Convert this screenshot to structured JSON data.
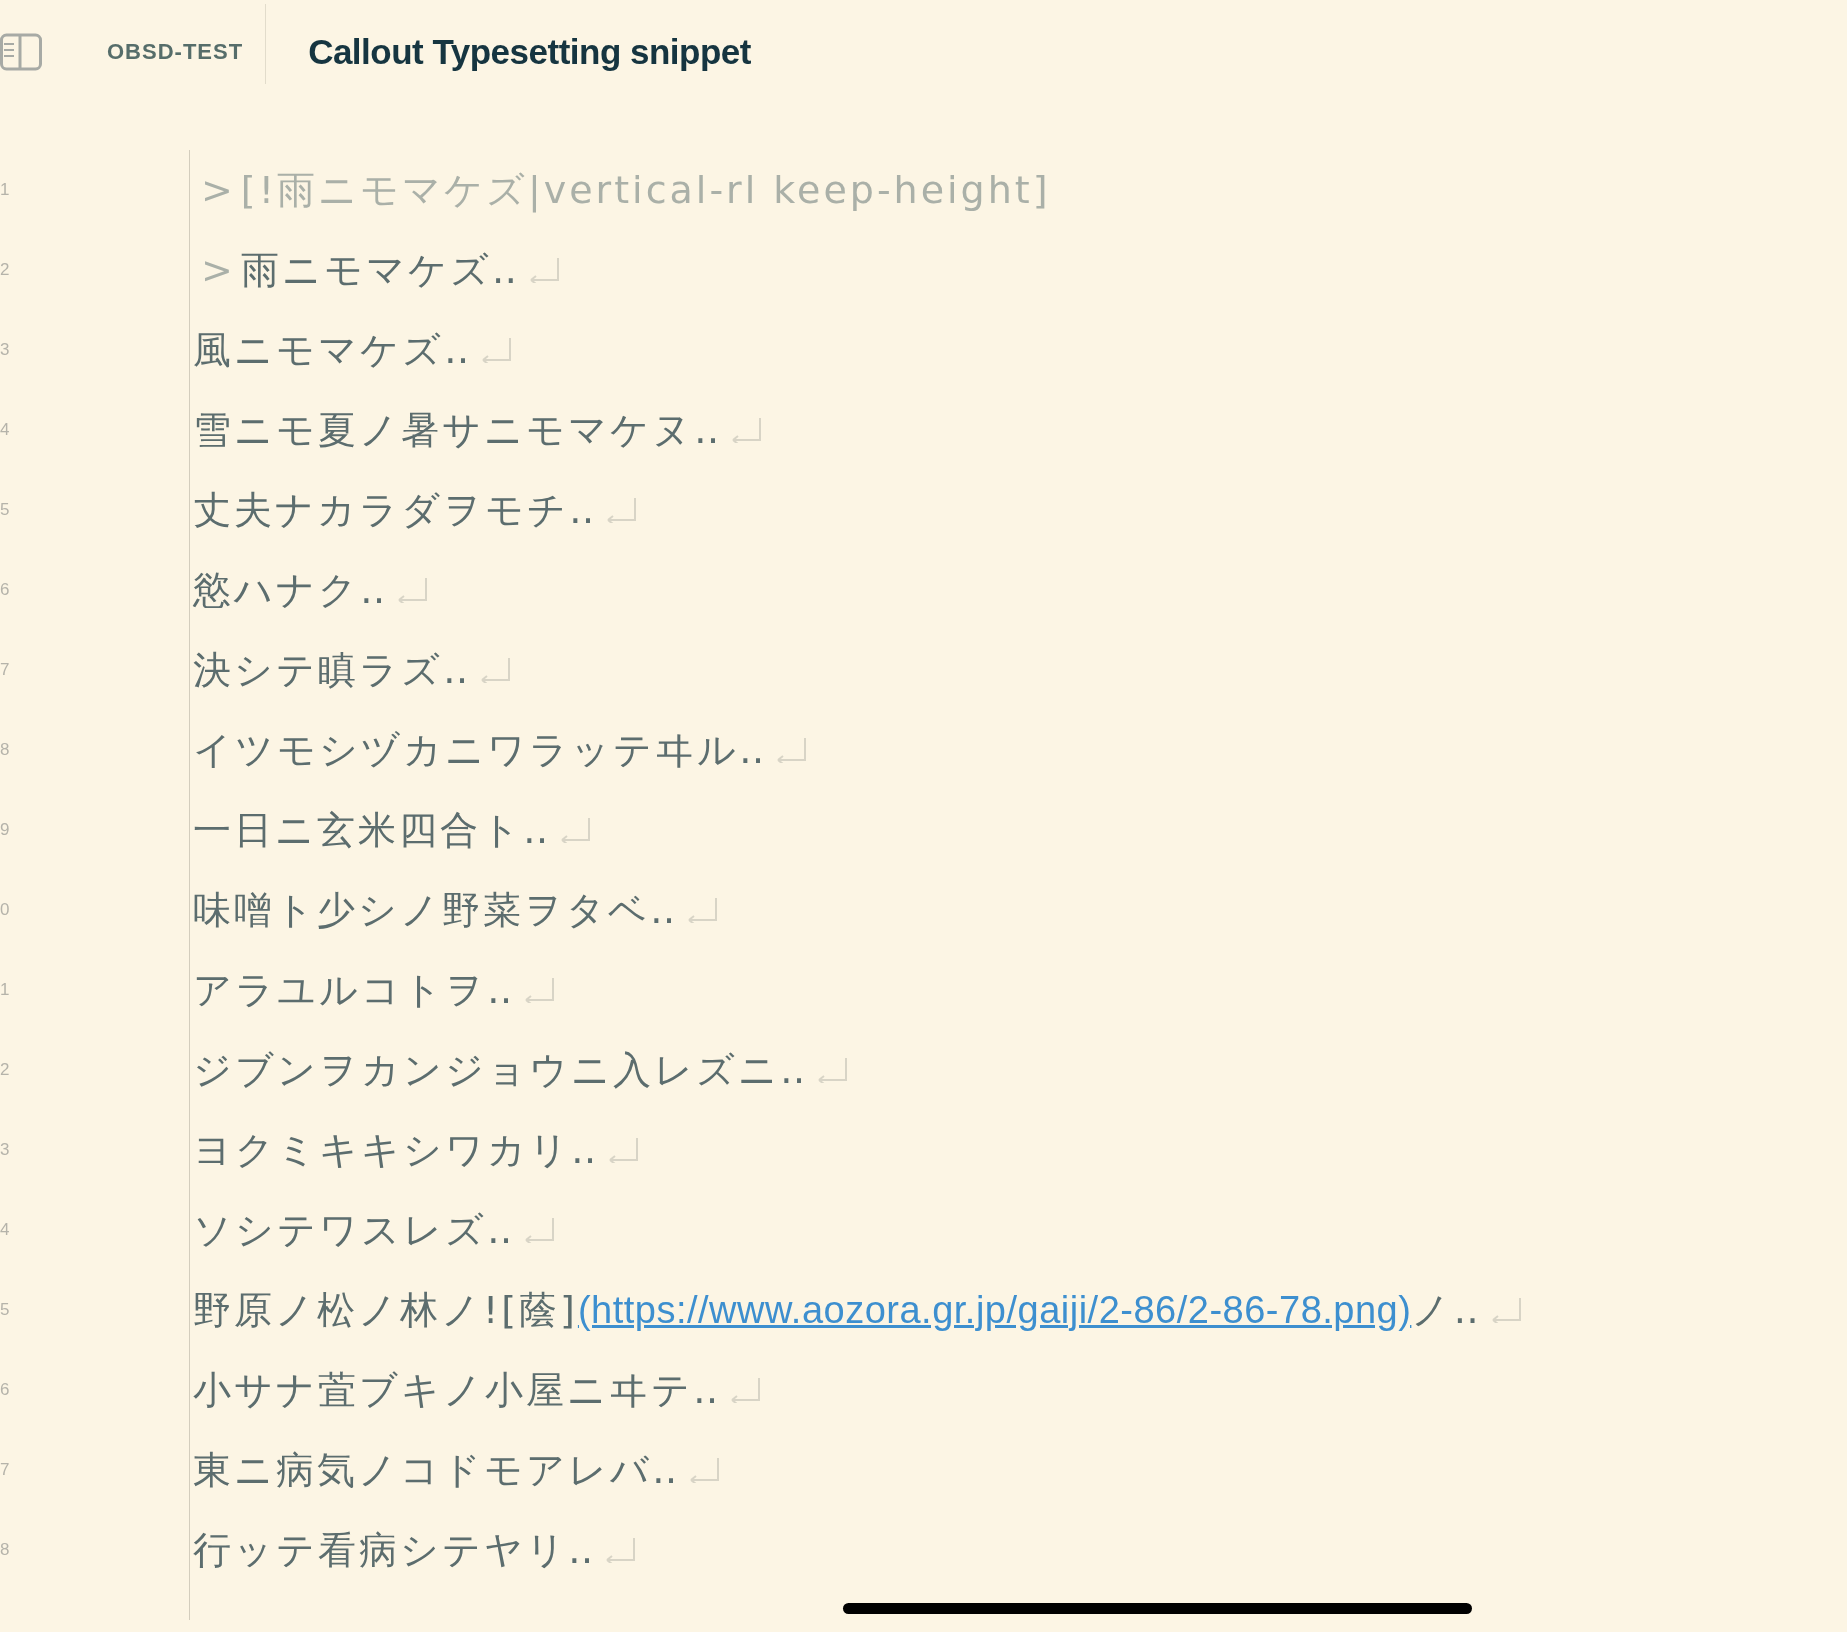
{
  "header": {
    "vault": "OBSD-TEST",
    "title": "Callout Typesetting snippet"
  },
  "lines": [
    {
      "number": "1",
      "kind": "callout-header",
      "marker": ">",
      "text": "[!雨ニモマケズ|vertical-rl keep-height]",
      "line_end": false
    },
    {
      "number": "2",
      "kind": "quote",
      "marker": ">",
      "text": "雨ニモマケズ‥",
      "line_end": true
    },
    {
      "number": "3",
      "kind": "text",
      "text": "風ニモマケズ‥",
      "line_end": true
    },
    {
      "number": "4",
      "kind": "text",
      "text": "雪ニモ夏ノ暑サニモマケヌ‥",
      "line_end": true
    },
    {
      "number": "5",
      "kind": "text",
      "text": "丈夫ナカラダヲモチ‥",
      "line_end": true
    },
    {
      "number": "6",
      "kind": "text",
      "text": "慾ハナク‥",
      "line_end": true
    },
    {
      "number": "7",
      "kind": "text",
      "text": "決シテ瞋ラズ‥",
      "line_end": true
    },
    {
      "number": "8",
      "kind": "text",
      "text": "イツモシヅカニワラッテヰル‥",
      "line_end": true
    },
    {
      "number": "9",
      "kind": "text",
      "text": "一日ニ玄米四合ト‥",
      "line_end": true
    },
    {
      "number": "0",
      "kind": "text",
      "text": "味噌ト少シノ野菜ヲタベ‥",
      "line_end": true
    },
    {
      "number": "1",
      "kind": "text",
      "text": "アラユルコトヲ‥",
      "line_end": true
    },
    {
      "number": "2",
      "kind": "text",
      "text": "ジブンヲカンジョウニ入レズニ‥",
      "line_end": true
    },
    {
      "number": "3",
      "kind": "text",
      "text": "ヨクミキキシワカリ‥",
      "line_end": true
    },
    {
      "number": "4",
      "kind": "text",
      "text": "ソシテワスレズ‥",
      "line_end": true
    },
    {
      "number": "5",
      "kind": "link",
      "text": "野原ノ松ノ林ノ![蔭]",
      "link": "(https://www.aozora.gr.jp/gaiji/2-86/2-86-78.png)",
      "after": "ノ‥",
      "line_end": true
    },
    {
      "number": "6",
      "kind": "text",
      "text": "小サナ萓ブキノ小屋ニヰテ‥",
      "line_end": true
    },
    {
      "number": "7",
      "kind": "text",
      "text": "東ニ病気ノコドモアレバ‥",
      "line_end": true
    },
    {
      "number": "8",
      "kind": "text",
      "text": "行ッテ看病シテヤリ‥",
      "line_end": true
    }
  ]
}
